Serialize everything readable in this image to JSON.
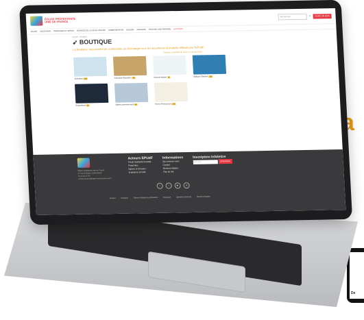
{
  "site": {
    "logo_text": "ÉGLISE PROTESTANTE\nUNIE DE FRANCE",
    "search_placeholder": "Rechercher",
    "cta": "FAIRE UN DON",
    "nav": [
      "ÉGLISE",
      "DÉCOUVRIR",
      "TÉMOIGNER ET SERVIR",
      "SOURCES DE LA VIE DE L'ÉGLISE",
      "COMMUNICATION",
      "ÉGLISES",
      "ANNUAIRE",
      "TROUVER UNE PAROISSE",
      "BOUTIQUE"
    ],
    "breadcrumb": "Accueil  >  Boutique",
    "page_title": "BOUTIQUE",
    "intro": "La Boutique vous permet de commander ou télécharger tous les documents et produits diffusés par l'EPUdF.",
    "terms": "Conditions générales de vente (1.2 octobre 2020)",
    "products": [
      {
        "label": "Animation",
        "count": "108",
        "color": "#cfe3ef"
      },
      {
        "label": "Animation financière",
        "count": "48",
        "color": "#c7a56a"
      },
      {
        "label": "Documentation",
        "count": "11",
        "color": "#eef3f6"
      },
      {
        "label": "Éditions Olivétan",
        "count": "216",
        "color": "#2f7fb5"
      },
      {
        "label": "Expositions",
        "count": "13",
        "color": "#1e2a3a"
      },
      {
        "label": "Objets promotionnels",
        "count": "45",
        "color": "#b7c9d8"
      },
      {
        "label": "Revue Ressources",
        "count": "101",
        "color": "#f3efe2"
      }
    ],
    "footer": {
      "address": "Église protestante unie de France\n47 rue de Clichy 75009 PARIS\n01 44 53 47 00\ncommunication@eglise-protestante-unie.fr",
      "acteurs_title": "Acteurs EPUdF",
      "acteurs": [
        "Fonds Solidarité Entraide",
        "Fraternités",
        "Églises et Groupes",
        "Institutions EPUdF"
      ],
      "infos_title": "Informations",
      "infos": [
        "Qui sommes-nous",
        "Contact",
        "Mentions légales",
        "Plan du site"
      ],
      "newsletter_title": "Inscription Infolettre",
      "newsletter_placeholder": "Votre email",
      "newsletter_btn": "S'INSCRIRE",
      "links": [
        "Contact",
        "Boutique",
        "Offres d'emplois & publications",
        "Glossaire",
        "Questions diverses",
        "Mentions légales"
      ]
    }
  },
  "background": {
    "partial_letter": "a",
    "phone_text": "De"
  },
  "colors": {
    "brand_red": "#e63946",
    "accent_orange": "#e39a1b",
    "footer_bg": "#3a3a3c"
  }
}
